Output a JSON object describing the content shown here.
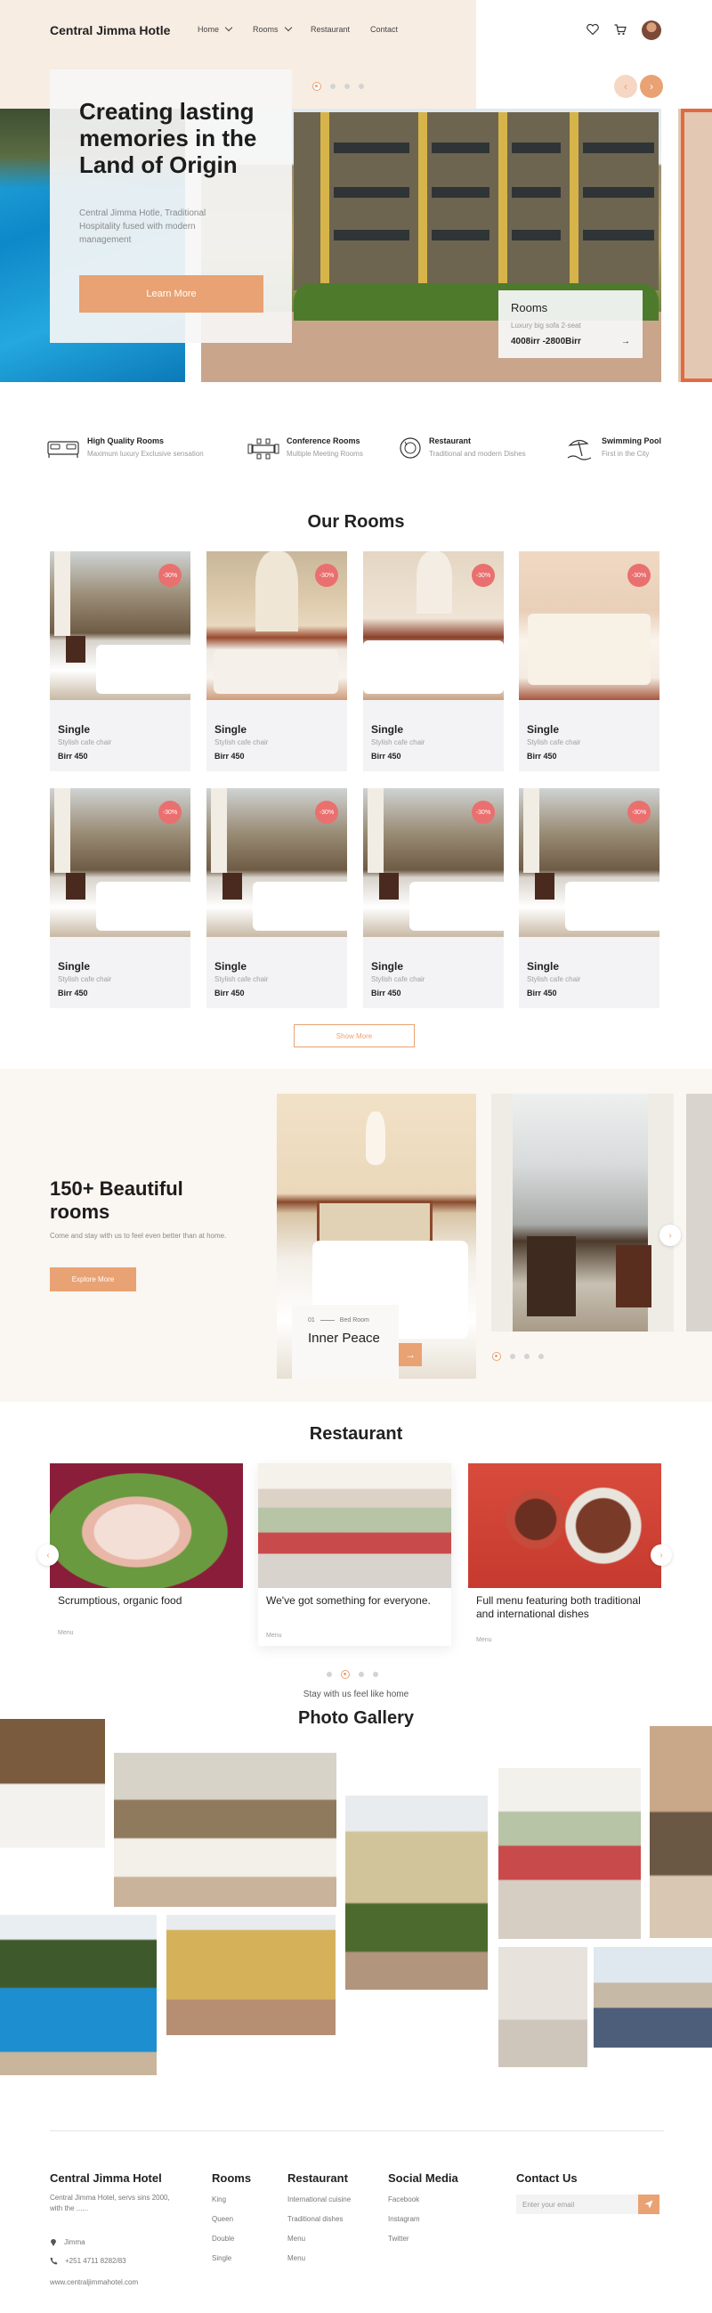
{
  "header": {
    "brand": "Central Jimma Hotle",
    "nav": {
      "home": "Home",
      "rooms": "Rooms",
      "restaurant": "Restaurant",
      "contact": "Contact"
    }
  },
  "hero": {
    "title": "Creating lasting memories in the Land of Origin",
    "subtitle": "Central Jimma Hotle, Traditional Hospitality fused with modern management",
    "button": "Learn More",
    "card": {
      "title": "Rooms",
      "desc": "Luxury big sofa 2-seat",
      "price": "4008irr  -2800Birr"
    }
  },
  "features": [
    {
      "title": "High Quality Rooms",
      "sub": "Maximum luxury Exclusive sensation",
      "icon": "bed-icon"
    },
    {
      "title": "Conference Rooms",
      "sub": "Multiple Meeting Rooms",
      "icon": "conference-table-icon"
    },
    {
      "title": "Restaurant",
      "sub": "Traditional and modern Dishes",
      "icon": "restaurant-icon"
    },
    {
      "title": "Swimming Pool",
      "sub": "First in the City",
      "icon": "pool-umbrella-icon"
    }
  ],
  "rooms": {
    "title": "Our Rooms",
    "badge": "-30%",
    "items": [
      {
        "name": "Single",
        "desc": "Stylish cafe chair",
        "price": "Birr 450"
      },
      {
        "name": "Single",
        "desc": "Stylish cafe chair",
        "price": "Birr 450"
      },
      {
        "name": "Single",
        "desc": "Stylish cafe chair",
        "price": "Birr 450"
      },
      {
        "name": "Single",
        "desc": "Stylish cafe chair",
        "price": "Birr 450"
      },
      {
        "name": "Single",
        "desc": "Stylish cafe chair",
        "price": "Birr 450"
      },
      {
        "name": "Single",
        "desc": "Stylish cafe chair",
        "price": "Birr 450"
      },
      {
        "name": "Single",
        "desc": "Stylish cafe chair",
        "price": "Birr 450"
      },
      {
        "name": "Single",
        "desc": "Stylish cafe chair",
        "price": "Birr 450"
      }
    ],
    "show_more": "Show More"
  },
  "beautiful": {
    "title": "150+ Beautiful rooms",
    "sub": "Come and stay with us to feel even better than at home.",
    "button": "Explore More",
    "slide_num": "01",
    "slide_cat": "Bed Room",
    "slide_title": "Inner Peace"
  },
  "restaurant": {
    "title": "Restaurant",
    "items": [
      {
        "title": "Scrumptious, organic food",
        "tag": "Menu"
      },
      {
        "title": "We've got something for everyone.",
        "tag": "Menu"
      },
      {
        "title": "Full menu featuring both traditional and international dishes",
        "tag": "Menu"
      }
    ]
  },
  "gallery": {
    "subtitle": "Stay with us feel like home",
    "title": "Photo Gallery"
  },
  "footer": {
    "brand": "Central Jimma Hotel",
    "about": "Central Jimma Hotel, servs sins 2000, with the ......",
    "location": "Jimma",
    "phone": "+251 4711 8282/83",
    "website": "www.centraljimmahotel.com",
    "rooms_title": "Rooms",
    "rooms_items": [
      "King",
      "Queen",
      "Double",
      "Single"
    ],
    "rest_title": "Restaurant",
    "rest_items": [
      "International cuisine",
      "Traditional dishes",
      "Menu",
      "Menu"
    ],
    "social_title": "Social Media",
    "social_items": [
      "Facebook",
      "Instagram",
      "Twitter"
    ],
    "contact_title": "Contact Us",
    "email_placeholder": "Enter your email"
  },
  "colors": {
    "accent": "#e9a273",
    "badge": "#e9706f",
    "beige": "#f8ede3"
  }
}
